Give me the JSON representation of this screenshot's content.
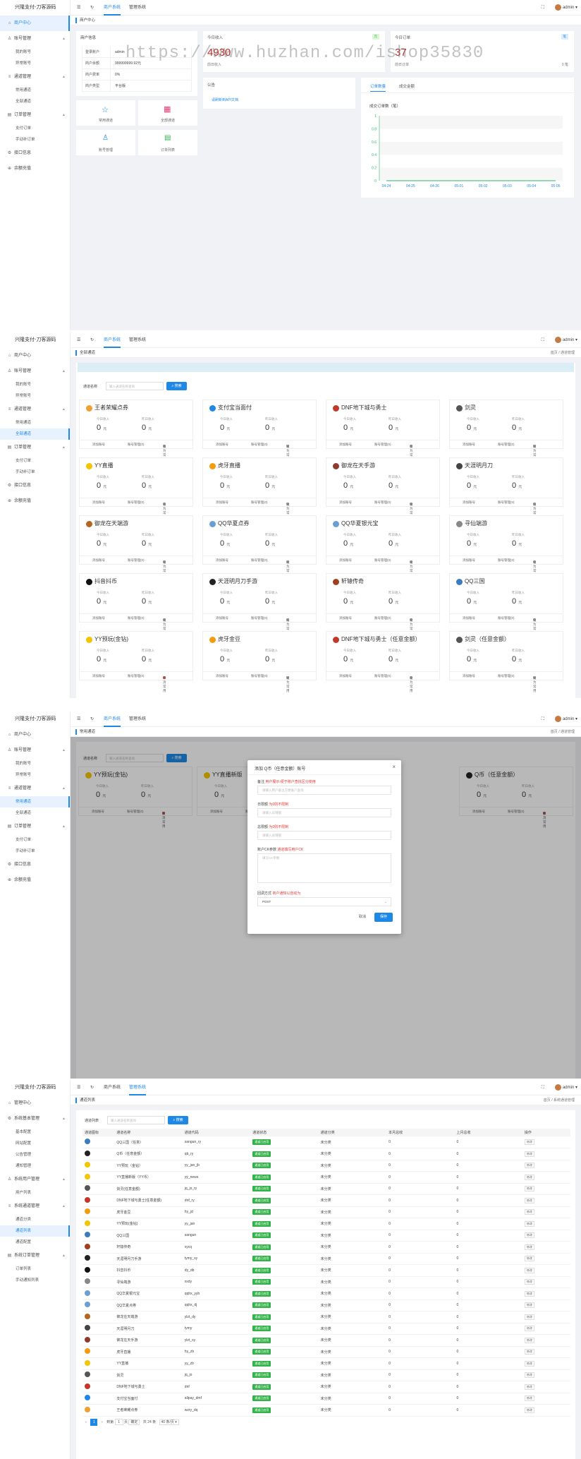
{
  "app_title": "兴隆支付-刀客源码",
  "user": "admin",
  "top_tabs": [
    "商户系统",
    "管理系统"
  ],
  "watermark": "https://www.huzhan.com/ishop35830",
  "screen1": {
    "breadcrumb": "商户中心",
    "sidebar": [
      {
        "label": "商户中心",
        "icon": "home-icon",
        "active": true
      },
      {
        "label": "账号管理",
        "icon": "user-icon",
        "children": [
          "我的账号",
          "异常账号"
        ]
      },
      {
        "label": "通道管理",
        "icon": "channel-icon",
        "children": [
          "常用通道",
          "全部通道"
        ]
      },
      {
        "label": "订单管理",
        "icon": "order-icon",
        "children": [
          "支付订单",
          "手动补订单"
        ]
      },
      {
        "label": "接口信息",
        "icon": "api-icon"
      },
      {
        "label": "余额充值",
        "icon": "recharge-icon"
      }
    ],
    "info": {
      "title": "商户信息",
      "rows": [
        [
          "登录账户",
          "admin"
        ],
        [
          "商户余额",
          "999999999.92元"
        ],
        [
          "商户费率",
          "0%"
        ],
        [
          "商户类型",
          "平台版"
        ]
      ]
    },
    "shortcuts": [
      "常用通道",
      "全部通道",
      "账号管理",
      "订单列表"
    ],
    "today_income": {
      "label": "今日收入",
      "value": "4930",
      "sub": "前日收入",
      "badge": "元"
    },
    "today_orders": {
      "label": "今日订单",
      "value": "37",
      "sub": "前日订单",
      "badge": "笔",
      "right": "0 笔"
    },
    "notice": {
      "title": "公告",
      "link": "请刷新到API文档"
    },
    "chart_tabs": [
      "订单数量",
      "成交金额"
    ]
  },
  "chart_data": {
    "type": "line",
    "title": "成交订单数（笔）",
    "categories": [
      "04-24",
      "04-25",
      "04-26",
      "05-01",
      "05-02",
      "05-03",
      "05-04",
      "05-05"
    ],
    "series": [
      {
        "values": [
          0,
          0,
          0,
          0,
          0,
          0,
          0,
          0
        ]
      }
    ],
    "y_ticks": [
      "1",
      "0.8",
      "0.6",
      "0.4",
      "0.2",
      "0"
    ],
    "ylim": [
      0,
      1
    ],
    "color": "#2eb872"
  },
  "screen2": {
    "breadcrumb": "全部通道",
    "search_label": "通道名称",
    "search_placeholder": "输入通道名称查询",
    "search_btn": "搜索",
    "stat_labels": [
      "今日收入",
      "昨日收入"
    ],
    "unit": "元",
    "actions": [
      "添加账号",
      "账号管理(0)",
      "设为常用",
      "取消常用"
    ],
    "cards": [
      {
        "name": "王者荣耀点券",
        "color": "#f0a030",
        "cancel": false
      },
      {
        "name": "支付宝当面付",
        "color": "#1e88e5",
        "cancel": false
      },
      {
        "name": "DNF地下城与勇士",
        "color": "#c0392b",
        "cancel": false
      },
      {
        "name": "剑灵",
        "color": "#555555",
        "cancel": false
      },
      {
        "name": "YY直播",
        "color": "#f5c400",
        "cancel": false
      },
      {
        "name": "虎牙直播",
        "color": "#f39c12",
        "cancel": false
      },
      {
        "name": "御龙在天手游",
        "color": "#8e3b2e",
        "cancel": false
      },
      {
        "name": "天涯明月刀",
        "color": "#444444",
        "cancel": false
      },
      {
        "name": "御龙在天端游",
        "color": "#b5651d",
        "cancel": false
      },
      {
        "name": "QQ华夏点券",
        "color": "#6a9fd4",
        "cancel": false
      },
      {
        "name": "QQ华夏银元宝",
        "color": "#6a9fd4",
        "cancel": false
      },
      {
        "name": "寻仙端游",
        "color": "#888888",
        "cancel": false
      },
      {
        "name": "抖音抖币",
        "color": "#111111",
        "cancel": false
      },
      {
        "name": "天涯明月刀手游",
        "color": "#222222",
        "cancel": false
      },
      {
        "name": "轩辕传奇",
        "color": "#a04020",
        "cancel": false
      },
      {
        "name": "QQ三国",
        "color": "#3b7bbf",
        "cancel": false
      },
      {
        "name": "YY预玩(金钻)",
        "color": "#f5c400",
        "cancel": true
      },
      {
        "name": "虎牙金豆",
        "color": "#f39c12",
        "cancel": false
      },
      {
        "name": "DNF地下城与勇士（任意金额）",
        "color": "#c0392b",
        "cancel": false
      },
      {
        "name": "剑灵（任意金额）",
        "color": "#555555",
        "cancel": false
      }
    ]
  },
  "screen3": {
    "breadcrumb": "常用通道",
    "path": [
      "首页",
      "通道管理"
    ],
    "search_label": "通道名称",
    "search_placeholder": "输入通道名称查询",
    "search_btn": "搜索",
    "visible_cards": [
      "YY预玩(金钻)",
      "YY直播新版",
      "Q币（任意金额）"
    ],
    "modal": {
      "title": "添加 Q币（任意金额）账号",
      "fields": [
        {
          "label": "备注",
          "hint": "用户展示:便于账户查找区分使用",
          "placeholder": "请输入用户备注方便账户查询"
        },
        {
          "label": "日限额",
          "hint": "为0则不限制",
          "placeholder": "请输入日限额"
        },
        {
          "label": "总限额",
          "hint": "为0则不限制",
          "placeholder": "请输入总限额"
        },
        {
          "label": "账户CK参数",
          "hint": "通道填写用户CK",
          "placeholder": "填写CK参数"
        },
        {
          "label": "回调方式",
          "hint": "商户通知以自动为",
          "placeholder": "POST"
        }
      ],
      "cancel": "取消",
      "save": "保存"
    }
  },
  "screen4": {
    "breadcrumb": "通道列表",
    "path": [
      "首页",
      "系统通道管理"
    ],
    "sidebar": [
      {
        "label": "管理中心",
        "icon": "home-icon"
      },
      {
        "label": "系统基本管理",
        "icon": "settings-icon",
        "children": [
          "基本配置",
          "网站配置",
          "公告管理",
          "通知管理"
        ]
      },
      {
        "label": "系统用户管理",
        "icon": "users-icon",
        "children": [
          "用户列表"
        ]
      },
      {
        "label": "系统通道管理",
        "icon": "channel-icon",
        "children": [
          "通道分类",
          "通道列表",
          "通道配置"
        ]
      },
      {
        "label": "系统订单管理",
        "icon": "order-icon",
        "children": [
          "订单列表",
          "手动通知列表"
        ]
      }
    ],
    "columns": [
      "通道图标",
      "通道名称",
      "通道代码",
      "通道状态",
      "通道分类",
      "本月总收",
      "上月总收",
      "操作"
    ],
    "status": "通道已启用",
    "category": "未分类",
    "edit": "修改",
    "rows": [
      [
        "QQ三国（任意）",
        "sangun_ry",
        "#3b7bbf"
      ],
      [
        "Q币（任意金额）",
        "qb_ry",
        "#222222"
      ],
      [
        "YY预玩（金钻）",
        "yy_jan_jb",
        "#f5c400"
      ],
      [
        "YY直播新版（YY币）",
        "yy_news",
        "#f5c400"
      ],
      [
        "剑灵(任意金额)",
        "jq_jo_ry",
        "#555555"
      ],
      [
        "DNF地下城与勇士(任意金额)",
        "dnf_ry",
        "#c0392b"
      ],
      [
        "虎牙金豆",
        "hy_jd",
        "#f39c12"
      ],
      [
        "YY预玩(金钻)",
        "yy_jan",
        "#f5c400"
      ],
      [
        "QQ三国",
        "sangun",
        "#3b7bbf"
      ],
      [
        "轩辕传奇",
        "xycq",
        "#a04020"
      ],
      [
        "天涯明月刀手游",
        "tymy_sy",
        "#222222"
      ],
      [
        "抖音抖币",
        "dy_db",
        "#111111"
      ],
      [
        "寻仙端游",
        "xxdy",
        "#888888"
      ],
      [
        "QQ华夏银元宝",
        "qqhx_yyb",
        "#6a9fd4"
      ],
      [
        "QQ华夏点券",
        "qqhx_dj",
        "#6a9fd4"
      ],
      [
        "御龙在天端游",
        "ylzt_dy",
        "#b5651d"
      ],
      [
        "天涯明月刀",
        "tymy",
        "#444444"
      ],
      [
        "御龙在天手游",
        "ylzt_sy",
        "#8e3b2e"
      ],
      [
        "虎牙直播",
        "hy_zb",
        "#f39c12"
      ],
      [
        "YY直播",
        "yy_zb",
        "#f5c400"
      ],
      [
        "剑灵",
        "jq_jo",
        "#555555"
      ],
      [
        "DNF地下城与勇士",
        "dnf",
        "#c0392b"
      ],
      [
        "支付宝当面付",
        "alipay_dmf",
        "#1e88e5"
      ],
      [
        "王者荣耀点券",
        "wzry_dq",
        "#f0a030"
      ]
    ],
    "month_value": "0",
    "pager": {
      "current": "1",
      "goto": "到第",
      "page_unit": "页",
      "confirm": "确定",
      "total": "共 24 条",
      "per_page": "40 条/页"
    }
  }
}
